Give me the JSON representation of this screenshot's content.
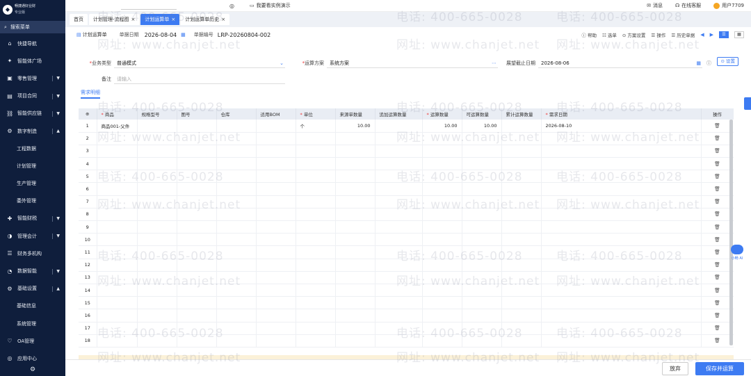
{
  "brand": {
    "name": "畅捷通好业财",
    "edition": "专业版"
  },
  "sidebar": {
    "search_label": "搜索菜单",
    "items": [
      {
        "label": "快捷导航",
        "icon": "home-icon"
      },
      {
        "label": "智能体广场",
        "icon": "sparkle-icon"
      },
      {
        "label": "零售管理",
        "icon": "store-icon",
        "expandable": true
      },
      {
        "label": "项目合同",
        "icon": "contract-icon",
        "expandable": true
      },
      {
        "label": "智能供应链",
        "icon": "supply-icon",
        "expandable": true
      },
      {
        "label": "数字制造",
        "icon": "factory-icon",
        "expandable": true,
        "expanded": true
      }
    ],
    "sub_items": [
      "工程数据",
      "计划管理",
      "生产管理",
      "委外管理"
    ],
    "items2": [
      {
        "label": "智能财税",
        "icon": "tax-icon",
        "expandable": true
      },
      {
        "label": "管理会计",
        "icon": "accounting-icon",
        "expandable": true
      },
      {
        "label": "财务多机构",
        "icon": "branches-icon"
      },
      {
        "label": "数据智能",
        "icon": "data-icon",
        "expandable": true
      },
      {
        "label": "基础设置",
        "icon": "settings-icon",
        "expandable": true,
        "expanded": true
      }
    ],
    "sub_items2": [
      "基础信息",
      "系统管理"
    ],
    "items3": [
      {
        "label": "OA管理",
        "icon": "oa-icon"
      },
      {
        "label": "应用中心",
        "icon": "apps-icon"
      }
    ]
  },
  "topbar": {
    "demo_label": "我要看实例演示",
    "messages_label": "消息",
    "service_label": "在线客服",
    "user_label": "用户7709"
  },
  "tabs": [
    {
      "label": "首页",
      "closable": false,
      "active": false
    },
    {
      "label": "计划管理-流程图",
      "closable": true,
      "active": false
    },
    {
      "label": "计划运算单",
      "closable": true,
      "active": true
    },
    {
      "label": "计划运算单历史",
      "closable": true,
      "active": false
    }
  ],
  "pagehead": {
    "title": "计划运算单",
    "date_label": "单据日期",
    "date_value": "2026-08-04",
    "code_label": "单据编号",
    "code_value": "LRP-20260804-002",
    "tools": [
      "帮助",
      "选单",
      "方案设置",
      "操作",
      "历史单据"
    ]
  },
  "form": {
    "biz_type_label": "业务类型",
    "biz_type_value": "普通模式",
    "scheme_label": "运算方案",
    "scheme_value": "系统方案",
    "deadline_label": "展望截止日期",
    "deadline_value": "2026-08-06",
    "setting_label": "设置",
    "remark_label": "备注",
    "remark_placeholder": "请输入"
  },
  "section_tab": "需求明细",
  "table": {
    "headers": [
      {
        "label": "商品",
        "required": true
      },
      {
        "label": "规格型号",
        "required": false
      },
      {
        "label": "图号",
        "required": false
      },
      {
        "label": "仓库",
        "required": false
      },
      {
        "label": "适用BOM",
        "required": false
      },
      {
        "label": "单位",
        "required": true
      },
      {
        "label": "来源单数量",
        "required": false
      },
      {
        "label": "追加运算数量",
        "required": false
      },
      {
        "label": "运算数量",
        "required": true
      },
      {
        "label": "可运算数量",
        "required": false
      },
      {
        "label": "累计运算数量",
        "required": false
      },
      {
        "label": "需求日期",
        "required": true
      },
      {
        "label": "操作",
        "required": false
      }
    ],
    "rows": [
      {
        "idx": "1",
        "product": "商品001-父件",
        "spec": "",
        "drawing": "",
        "warehouse": "",
        "bom": "",
        "unit": "个",
        "src_qty": "10.00",
        "add_qty": "",
        "calc_qty": "10.00",
        "avail_qty": "10.00",
        "cum_qty": "",
        "date": "2026-08-10"
      },
      {
        "idx": "2"
      },
      {
        "idx": "3"
      },
      {
        "idx": "4"
      },
      {
        "idx": "5"
      },
      {
        "idx": "6"
      },
      {
        "idx": "7"
      },
      {
        "idx": "8"
      },
      {
        "idx": "9"
      },
      {
        "idx": "10"
      },
      {
        "idx": "11"
      },
      {
        "idx": "12"
      },
      {
        "idx": "13"
      },
      {
        "idx": "14"
      },
      {
        "idx": "15"
      },
      {
        "idx": "16"
      },
      {
        "idx": "17"
      },
      {
        "idx": "18"
      }
    ]
  },
  "actions": {
    "cancel_label": "放弃",
    "save_label": "保存并运算"
  },
  "watermark": {
    "phone": "电话: 400-665-0028",
    "site": "网址: www.chanjet.net"
  },
  "ai_label": "小畅 AI",
  "colors": {
    "accent": "#3d7bf2",
    "sidebar_bg": "#0f1e3c"
  }
}
